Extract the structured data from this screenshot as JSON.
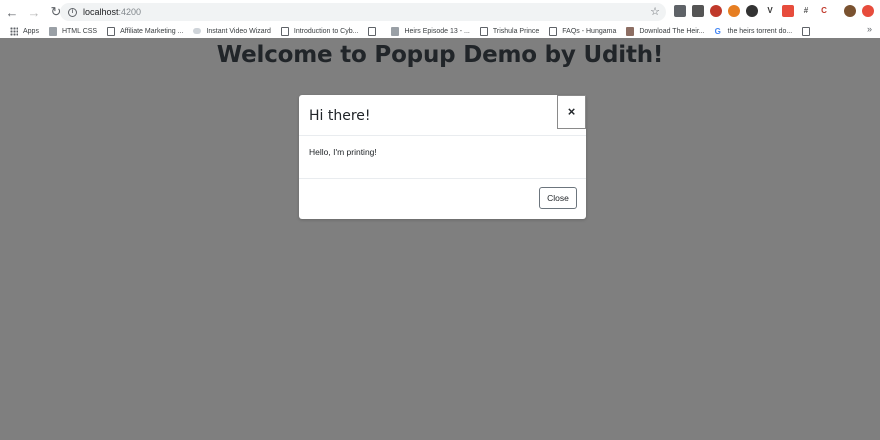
{
  "browser": {
    "url_host": "localhost",
    "url_port": ":4200",
    "extension_icons": [
      "screenshot-icon",
      "lastpass-icon",
      "colorful-icon",
      "vpn-icon",
      "grammarly-icon",
      "vue-icon",
      "notification-badge-icon",
      "hashtag-icon",
      "c-bracket-icon",
      "avatar",
      "settings-icon"
    ],
    "bookmarks": [
      {
        "label": "Apps",
        "icon": "apps-grid-icon"
      },
      {
        "label": "HTML CSS",
        "icon": "image-icon"
      },
      {
        "label": "Affiliate Marketing ...",
        "icon": "page-icon"
      },
      {
        "label": "Instant Video Wizard",
        "icon": "cloud-icon"
      },
      {
        "label": "Introduction to Cyb...",
        "icon": "page-icon"
      },
      {
        "label": "",
        "icon": "page-icon"
      },
      {
        "label": "Heirs Episode 13 - ...",
        "icon": "shield-icon"
      },
      {
        "label": "Trishula Prince",
        "icon": "page-icon"
      },
      {
        "label": "FAQs - Hungama",
        "icon": "page-icon"
      },
      {
        "label": "Download The Heir...",
        "icon": "shield-icon"
      },
      {
        "label": "the heirs torrent do...",
        "icon": "google-icon"
      },
      {
        "label": "",
        "icon": "page-icon"
      }
    ],
    "more_label": "»"
  },
  "page": {
    "title": "Welcome to Popup Demo by Udith!"
  },
  "modal": {
    "title": "Hi there!",
    "close_x": "×",
    "body": "Hello, I'm printing!",
    "close_button": "Close"
  }
}
